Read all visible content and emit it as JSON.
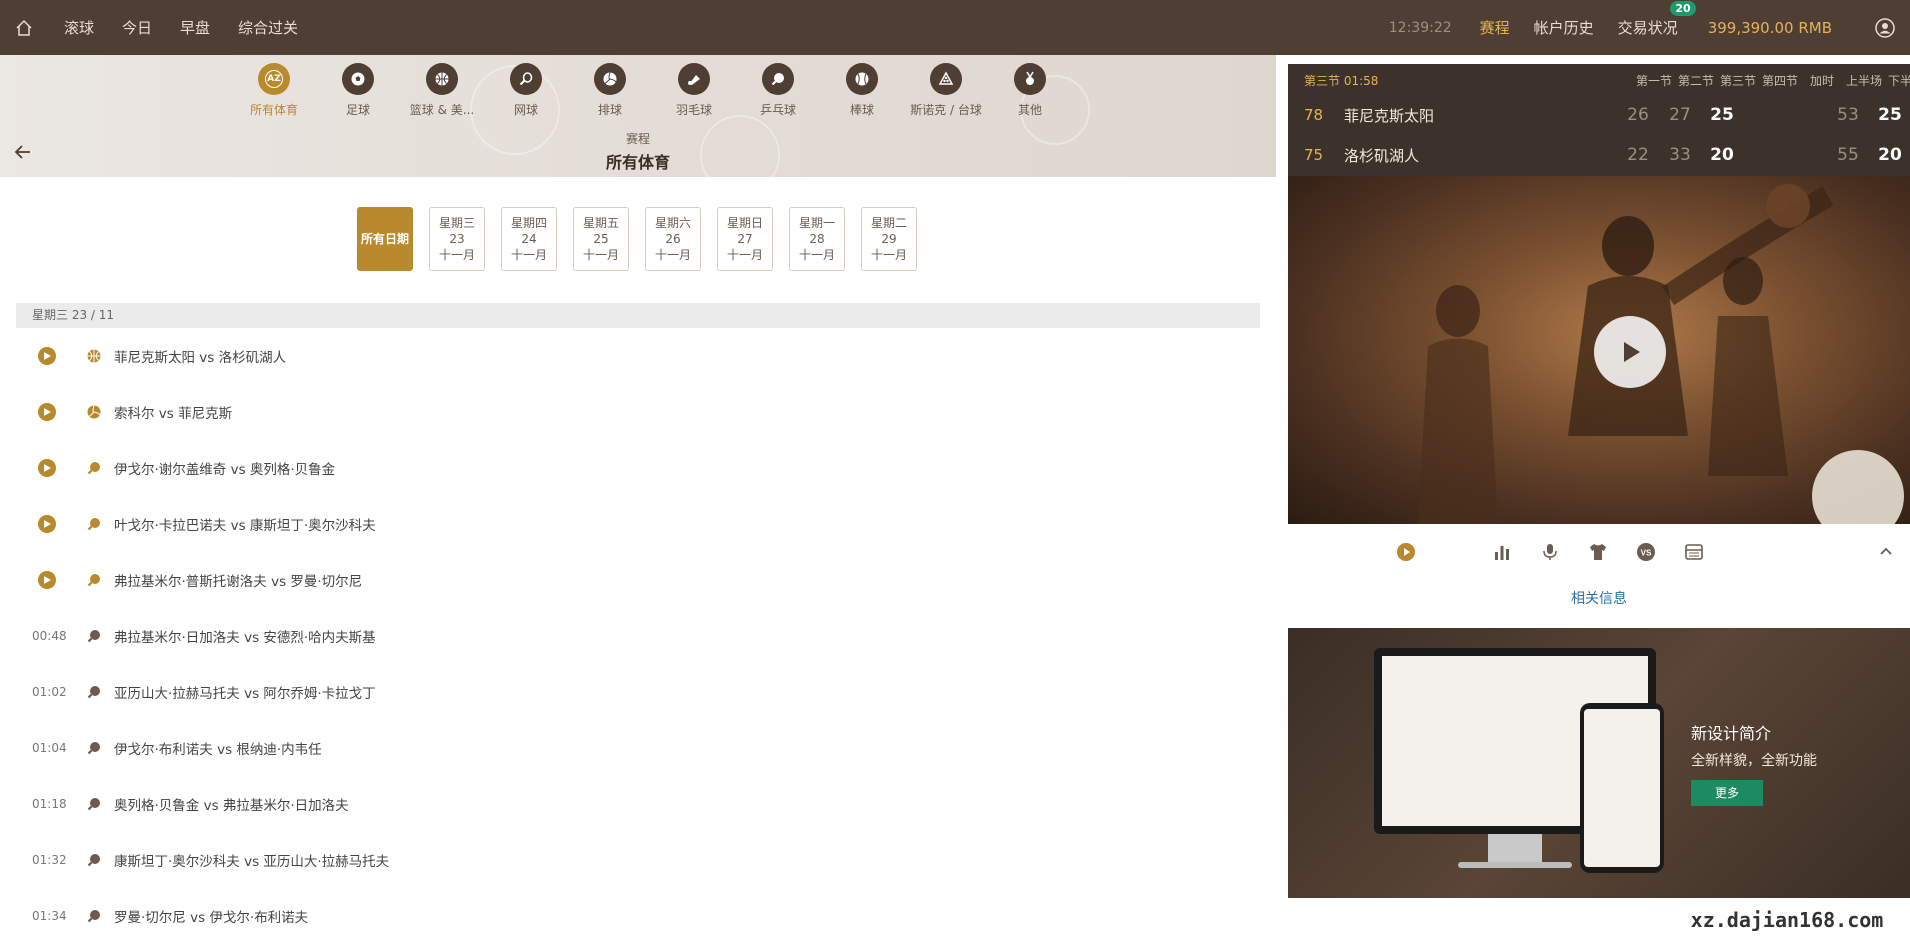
{
  "topbar": {
    "nav": [
      "滚球",
      "今日",
      "早盘",
      "综合过关"
    ],
    "clock": "12:39:22",
    "right_items": [
      "赛程",
      "帐户历史",
      "交易状况"
    ],
    "badge": "20",
    "balance": "399,390.00 RMB"
  },
  "sports": [
    {
      "label": "所有体育",
      "icon": "az-icon",
      "badge": "AZ"
    },
    {
      "label": "足球",
      "icon": "soccer-icon"
    },
    {
      "label": "篮球 & 美...",
      "icon": "basketball-icon"
    },
    {
      "label": "网球",
      "icon": "tennis-icon"
    },
    {
      "label": "排球",
      "icon": "volleyball-icon"
    },
    {
      "label": "羽毛球",
      "icon": "badminton-icon"
    },
    {
      "label": "乒乓球",
      "icon": "table-tennis-icon"
    },
    {
      "label": "棒球",
      "icon": "baseball-icon"
    },
    {
      "label": "斯诺克 / 台球",
      "icon": "snooker-icon"
    },
    {
      "label": "其他",
      "icon": "medal-icon"
    }
  ],
  "schedule": {
    "subtitle": "赛程",
    "title": "所有体育"
  },
  "dates": {
    "all": "所有日期",
    "days": [
      {
        "weekday": "星期三",
        "day": "23",
        "month": "十一月"
      },
      {
        "weekday": "星期四",
        "day": "24",
        "month": "十一月"
      },
      {
        "weekday": "星期五",
        "day": "25",
        "month": "十一月"
      },
      {
        "weekday": "星期六",
        "day": "26",
        "month": "十一月"
      },
      {
        "weekday": "星期日",
        "day": "27",
        "month": "十一月"
      },
      {
        "weekday": "星期一",
        "day": "28",
        "month": "十一月"
      },
      {
        "weekday": "星期二",
        "day": "29",
        "month": "十一月"
      }
    ]
  },
  "day_header": "星期三 23 / 11",
  "matches": [
    {
      "time": "",
      "live": true,
      "sport": "basketball",
      "name": "菲尼克斯太阳 vs 洛杉矶湖人"
    },
    {
      "time": "",
      "live": true,
      "sport": "volleyball",
      "name": "索科尔 vs 菲尼克斯"
    },
    {
      "time": "",
      "live": true,
      "sport": "table-tennis",
      "name": "伊戈尔·谢尔盖维奇 vs 奥列格·贝鲁金"
    },
    {
      "time": "",
      "live": true,
      "sport": "table-tennis",
      "name": "叶戈尔·卡拉巴诺夫 vs 康斯坦丁·奥尔沙科夫"
    },
    {
      "time": "",
      "live": true,
      "sport": "table-tennis",
      "name": "弗拉基米尔·普斯托谢洛夫 vs 罗曼·切尔尼"
    },
    {
      "time": "00:48",
      "live": false,
      "sport": "table-tennis",
      "name": "弗拉基米尔·日加洛夫 vs 安德烈·哈内夫斯基"
    },
    {
      "time": "01:02",
      "live": false,
      "sport": "table-tennis",
      "name": "亚历山大·拉赫马托夫 vs 阿尔乔姆·卡拉戈丁"
    },
    {
      "time": "01:04",
      "live": false,
      "sport": "table-tennis",
      "name": "伊戈尔·布利诺夫 vs 根纳迪·内韦任"
    },
    {
      "time": "01:18",
      "live": false,
      "sport": "table-tennis",
      "name": "奥列格·贝鲁金 vs 弗拉基米尔·日加洛夫"
    },
    {
      "time": "01:32",
      "live": false,
      "sport": "table-tennis",
      "name": "康斯坦丁·奥尔沙科夫 vs 亚历山大·拉赫马托夫"
    },
    {
      "time": "01:34",
      "live": false,
      "sport": "table-tennis",
      "name": "罗曼·切尔尼 vs 伊戈尔·布利诺夫"
    }
  ],
  "scoreboard": {
    "period": "第三节 01:58",
    "columns": [
      "第一节",
      "第二节",
      "第三节",
      "第四节",
      "加时",
      "上半场",
      "下半场"
    ],
    "teams": [
      {
        "total": "78",
        "name": "菲尼克斯太阳",
        "q1": "26",
        "q2": "27",
        "q3": "25",
        "h1": "53",
        "h2": "25"
      },
      {
        "total": "75",
        "name": "洛杉矶湖人",
        "q1": "22",
        "q2": "33",
        "q3": "20",
        "h1": "55",
        "h2": "20"
      }
    ]
  },
  "related": "相关信息",
  "promo": {
    "title": "新设计简介",
    "subtitle": "全新样貌，全新功能",
    "button": "更多"
  },
  "watermark": "xz.dajian168.com",
  "colors": {
    "brand": "#4e3e33",
    "accent": "#b8892d",
    "gold": "#e4b258"
  }
}
